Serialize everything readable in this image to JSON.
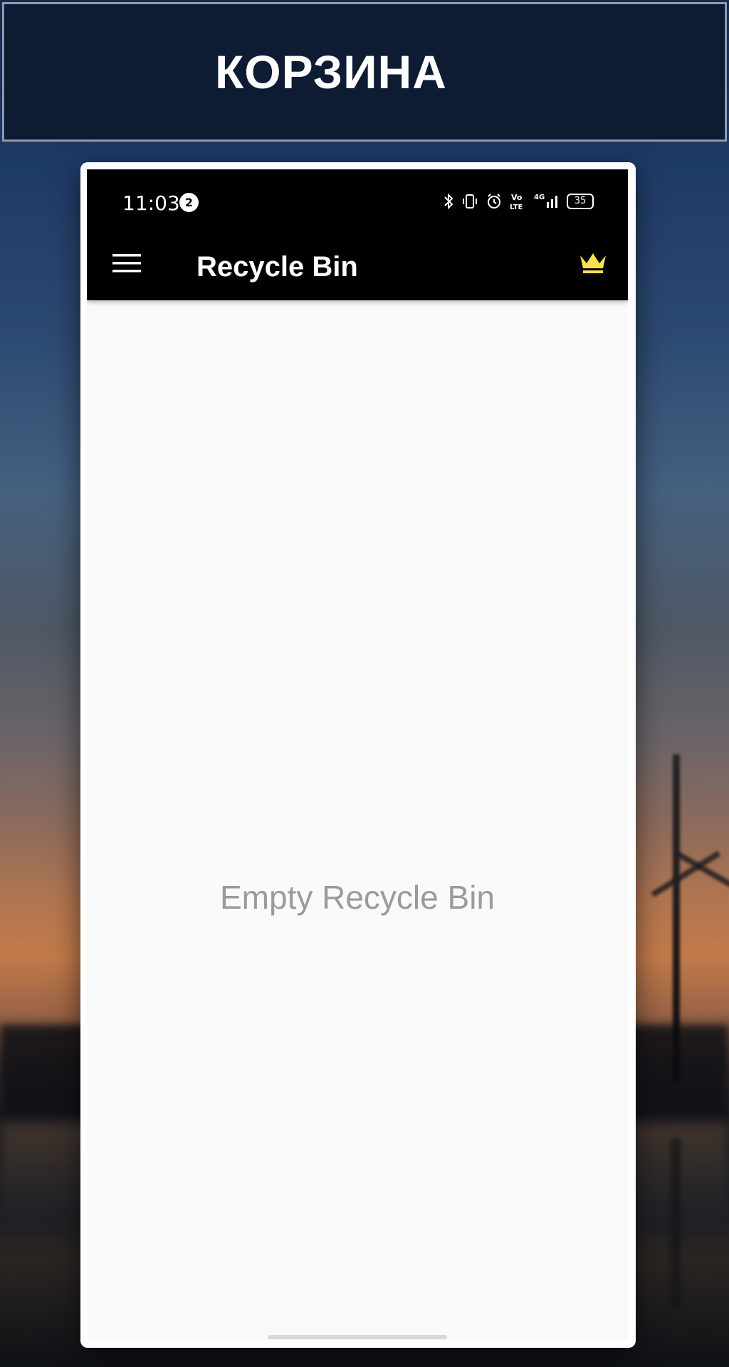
{
  "banner": {
    "title": "КОРЗИНА"
  },
  "status_bar": {
    "time": "11:03",
    "notification_count": "2",
    "battery_level": "35",
    "network_label": "4G",
    "icons": [
      "bluetooth-icon",
      "vibrate-icon",
      "alarm-icon",
      "volte-icon",
      "signal-icon",
      "battery-icon"
    ]
  },
  "app_bar": {
    "title": "Recycle Bin",
    "menu_icon": "hamburger-menu-icon",
    "premium_icon": "crown-icon",
    "premium_color": "#FFE14D"
  },
  "content": {
    "empty_message": "Empty Recycle Bin"
  },
  "colors": {
    "banner_background": "#0D1B33",
    "app_bar_background": "#000000",
    "screen_background": "#FAFAFA",
    "empty_text": "#9B9B9B"
  }
}
